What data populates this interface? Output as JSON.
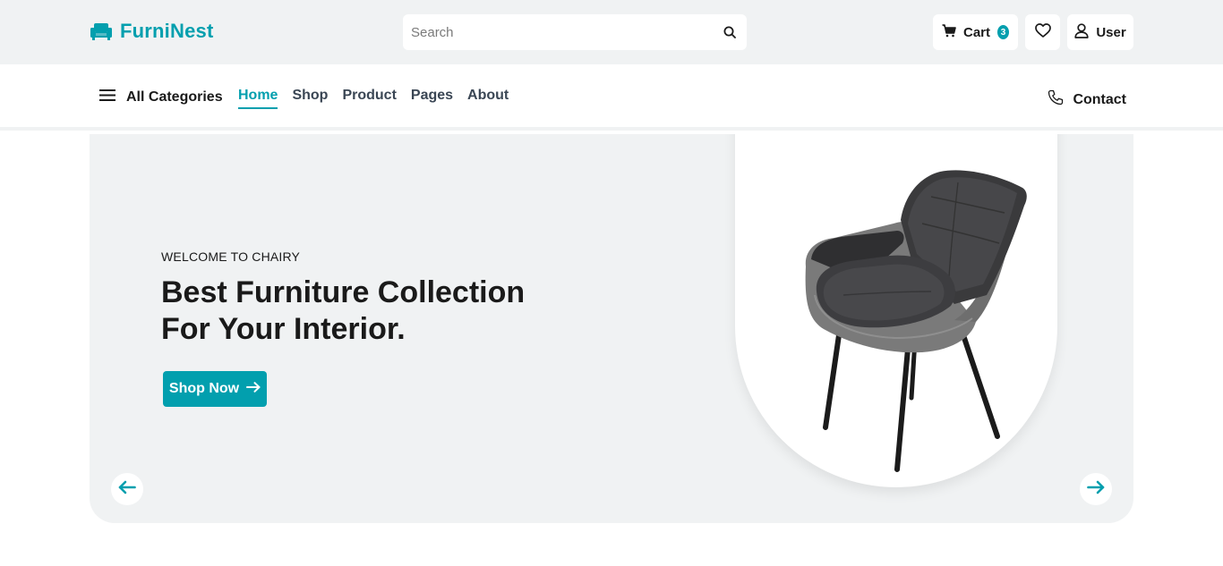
{
  "brand": {
    "name": "FurniNest",
    "accent": "#029fae",
    "logo_icon": "armchair-icon"
  },
  "search": {
    "placeholder": "Search",
    "icon": "search-icon"
  },
  "top_actions": {
    "cart_label": "Cart",
    "cart_count": "3",
    "wishlist_icon": "heart-icon",
    "user_label": "User"
  },
  "nav": {
    "categories_label": "All Categories",
    "links": [
      {
        "label": "Home",
        "active": true
      },
      {
        "label": "Shop"
      },
      {
        "label": "Product"
      },
      {
        "label": "Pages"
      },
      {
        "label": "About"
      }
    ],
    "contact_label": "Contact"
  },
  "hero": {
    "subtitle": "WELCOME TO CHAIRY",
    "title_line1": "Best Furniture Collection",
    "title_line2": "For Your Interior.",
    "cta_label": "Shop Now",
    "image": "armchair-image"
  }
}
